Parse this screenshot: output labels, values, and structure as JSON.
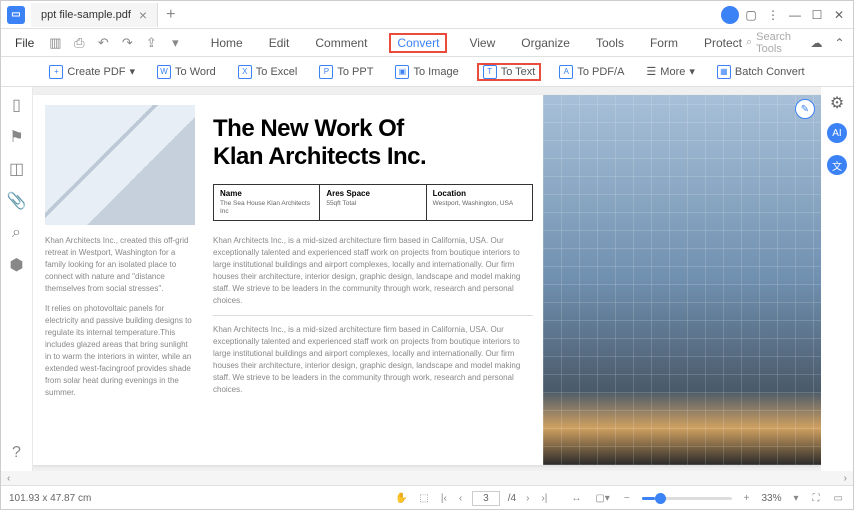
{
  "titlebar": {
    "tab_title": "ppt file-sample.pdf"
  },
  "menubar": {
    "file": "File",
    "tabs": [
      "Home",
      "Edit",
      "Comment",
      "Convert",
      "View",
      "Organize",
      "Tools",
      "Form",
      "Protect"
    ],
    "active_tab": "Convert",
    "search_placeholder": "Search Tools"
  },
  "toolbar": {
    "create_pdf": "Create PDF",
    "to_word": "To Word",
    "to_excel": "To Excel",
    "to_ppt": "To PPT",
    "to_image": "To Image",
    "to_text": "To Text",
    "to_pdfa": "To PDF/A",
    "more": "More",
    "batch_convert": "Batch Convert"
  },
  "document": {
    "headline_l1": "The New Work Of",
    "headline_l2": "Klan Architects Inc.",
    "table": {
      "col1_label": "Name",
      "col1_val": "The Sea House Klan Architects Inc",
      "col2_label": "Ares Space",
      "col2_val": "55qft Total",
      "col3_label": "Location",
      "col3_val": "Westport, Washington, USA"
    },
    "left_p1": "Khan Architects Inc., created this off-grid retreat in Westport, Washington for a family looking for an isolated place to connect with nature and \"distance themselves from social stresses\".",
    "left_p2": "It relies on photovoltaic panels for electricity and passive building designs to regulate its internal temperature.This includes glazed areas that bring sunlight in to warm the interiors in winter, while an extended west-facingroof provides shade from solar heat during evenings in the summer.",
    "mid_p1": "Khan Architects Inc., is a mid-sized architecture firm based in California, USA. Our exceptionally talented and experienced staff work on projects from boutique interiors to large institutional buildings and airport complexes, locally and internationally. Our firm houses their architecture, interior design, graphic design, landscape and model making staff. We strieve to be leaders in the community through work, research and personal choices.",
    "mid_p2": "Khan Architects Inc., is a mid-sized architecture firm based in California, USA. Our exceptionally talented and experienced staff work on projects from boutique interiors to large institutional buildings and airport complexes, locally and internationally. Our firm houses their architecture, interior design, graphic design, landscape and model making staff. We strieve to be leaders in the community through work, research and personal choices."
  },
  "statusbar": {
    "dimensions": "101.93 x 47.87 cm",
    "page_current": "3",
    "page_total": "4",
    "zoom": "33%"
  }
}
